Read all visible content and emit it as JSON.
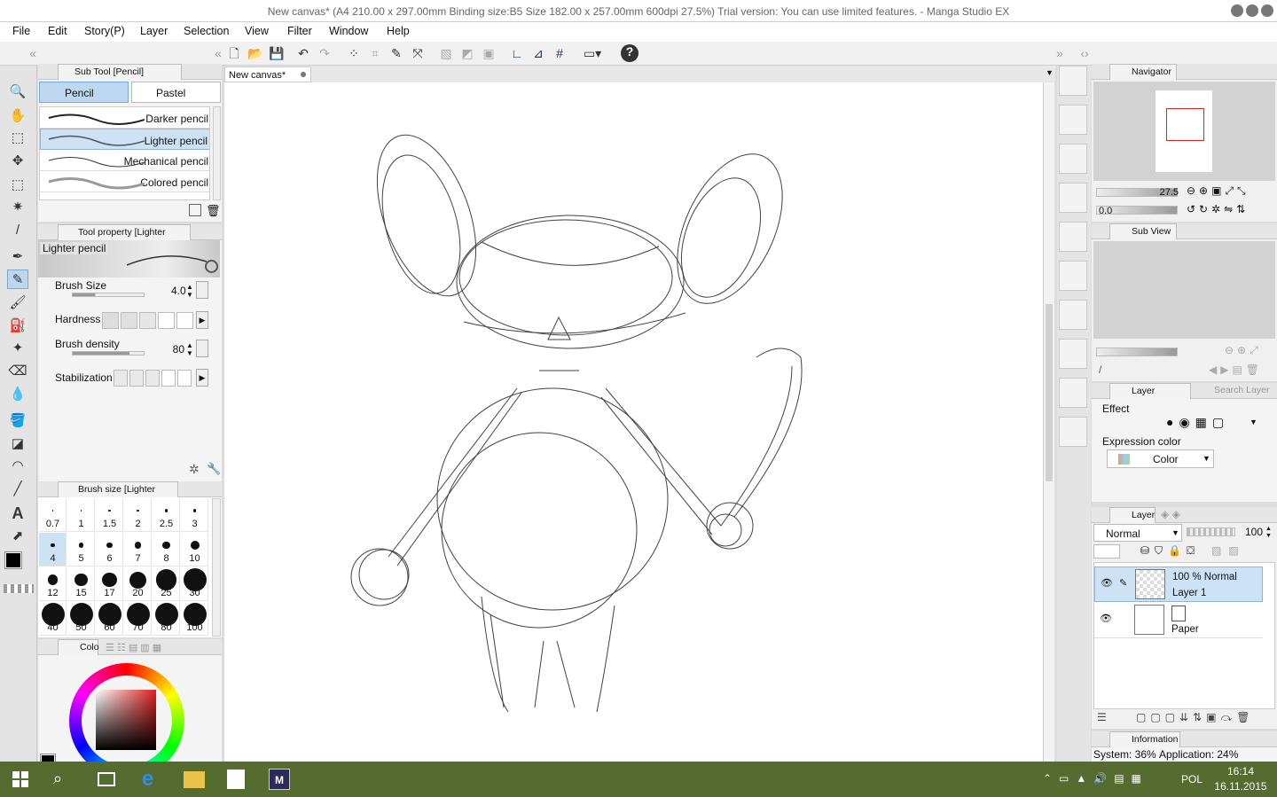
{
  "window": {
    "title": "New canvas* (A4 210.00 x 297.00mm Binding size:B5 Size 182.00 x 257.00mm 600dpi 27.5%)  Trial version: You can use limited features. - Manga Studio EX"
  },
  "menu": [
    "File",
    "Edit",
    "Story(P)",
    "Layer",
    "Selection",
    "View",
    "Filter",
    "Window",
    "Help"
  ],
  "subtool": {
    "title": "Sub Tool [Pencil]",
    "tabs": [
      "Pencil",
      "Pastel"
    ],
    "items": [
      "Darker pencil",
      "Lighter pencil",
      "Mechanical pencil",
      "Colored pencil"
    ]
  },
  "toolprop": {
    "title": "Tool property [Lighter pencil]",
    "preview_label": "Lighter pencil",
    "brush_size_label": "Brush Size",
    "brush_size_value": "4.0",
    "hardness_label": "Hardness",
    "density_label": "Brush density",
    "density_value": "80",
    "stabilization_label": "Stabilization"
  },
  "brushsize": {
    "title": "Brush size [Lighter pencil]",
    "values": [
      "0.7",
      "1",
      "1.5",
      "2",
      "2.5",
      "3",
      "4",
      "5",
      "6",
      "7",
      "8",
      "10",
      "12",
      "15",
      "17",
      "20",
      "25",
      "30",
      "40",
      "50",
      "60",
      "70",
      "80",
      "100"
    ]
  },
  "color": {
    "tab_label": "Colo"
  },
  "canvas": {
    "tab_label": "New canvas*"
  },
  "navigator": {
    "title": "Navigator",
    "zoom": "27.5",
    "rotation": "0.0"
  },
  "subview": {
    "title": "Sub View"
  },
  "layerprop": {
    "title": "Layer Property",
    "search_tab": "Search Layer",
    "effect_label": "Effect",
    "expression_label": "Expression color",
    "expression_value": "Color"
  },
  "layer": {
    "title": "Layer",
    "blend_mode": "Normal",
    "opacity": "100",
    "layers": [
      {
        "opacity_mode": "100 %  Normal",
        "name": "Layer 1"
      },
      {
        "name": "Paper"
      }
    ]
  },
  "info": {
    "title": "Information",
    "system": "System: 36%",
    "application": "Application: 24%"
  },
  "taskbar": {
    "lang": "POL",
    "time": "16:14",
    "date": "16.11.2015"
  }
}
